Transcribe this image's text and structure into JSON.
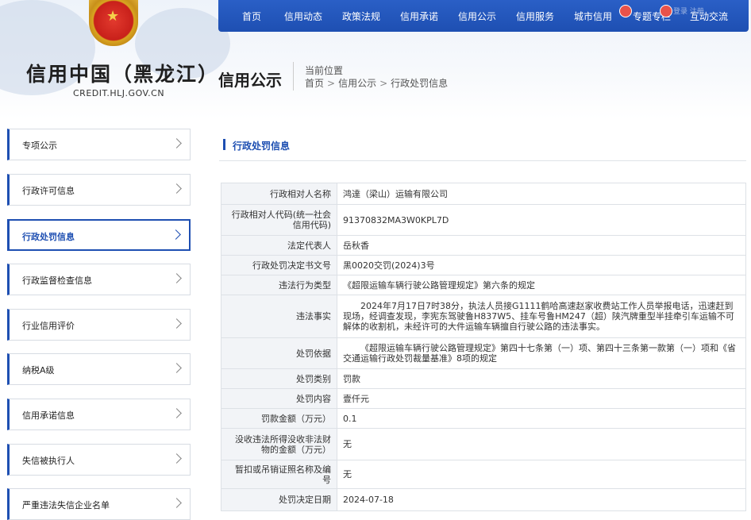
{
  "site": {
    "title": "信用中国（黑龙江）",
    "url": "CREDIT.HLJ.GOV.CN"
  },
  "nav": {
    "items": [
      "首页",
      "信用动态",
      "政策法规",
      "信用承诺",
      "信用公示",
      "信用服务",
      "城市信用",
      "专题专栏",
      "互动交流"
    ],
    "faint_text": "登录 注册"
  },
  "section": {
    "title": "信用公示",
    "location_label": "当前位置",
    "breadcrumb": [
      "首页",
      "信用公示",
      "行政处罚信息"
    ],
    "separator": ">"
  },
  "sidebar": {
    "items": [
      {
        "label": "专项公示",
        "active": false
      },
      {
        "label": "行政许可信息",
        "active": false
      },
      {
        "label": "行政处罚信息",
        "active": true
      },
      {
        "label": "行政监督检查信息",
        "active": false
      },
      {
        "label": "行业信用评价",
        "active": false
      },
      {
        "label": "纳税A级",
        "active": false
      },
      {
        "label": "信用承诺信息",
        "active": false
      },
      {
        "label": "失信被执行人",
        "active": false
      },
      {
        "label": "严重违法失信企业名单",
        "active": false
      }
    ]
  },
  "content": {
    "heading": "行政处罚信息",
    "rows": [
      {
        "key": "行政相对人名称",
        "value": "鸿達（梁山）运输有限公司"
      },
      {
        "key": "行政相对人代码(统一社会信用代码)",
        "value": "91370832MA3W0KPL7D"
      },
      {
        "key": "法定代表人",
        "value": "岳秋香"
      },
      {
        "key": "行政处罚决定书文号",
        "value": "黑0020交罚(2024)3号"
      },
      {
        "key": "违法行为类型",
        "value": "《超限运输车辆行驶公路管理规定》第六条的规定"
      },
      {
        "key": "违法事实",
        "value": "2024年7月17日7时38分，执法人员接G1111鹤哈高速赵家收费站工作人员举报电话，迅速赶到现场，经调查发现，李宪东驾驶鲁H837W5、挂车号鲁HM247（超）陕汽牌重型半挂牵引车运输不可解体的收割机，未经许可的大件运输车辆擅自行驶公路的违法事实。"
      },
      {
        "key": "处罚依据",
        "value": "《超限运输车辆行驶公路管理规定》第四十七条第（一）项、第四十三条第一款第（一）项和《省交通运输行政处罚裁量基准》8项的规定"
      },
      {
        "key": "处罚类别",
        "value": "罚款"
      },
      {
        "key": "处罚内容",
        "value": "壹仟元"
      },
      {
        "key": "罚款金额（万元）",
        "value": "0.1"
      },
      {
        "key": "没收违法所得没收非法财物的金额（万元）",
        "value": "无"
      },
      {
        "key": "暂扣或吊销证照名称及编号",
        "value": "无"
      },
      {
        "key": "处罚决定日期",
        "value": "2024-07-18"
      }
    ]
  }
}
